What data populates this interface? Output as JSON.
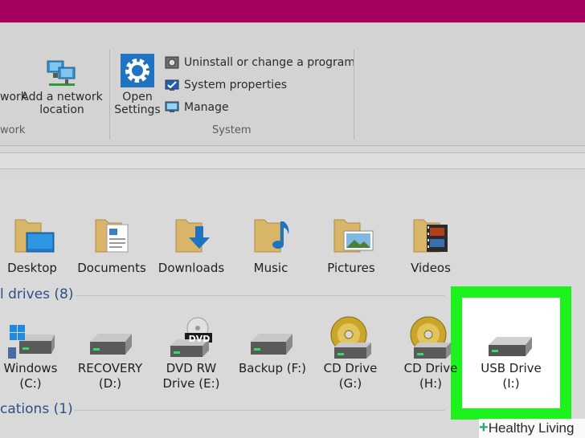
{
  "ribbon": {
    "network_group": {
      "partial_button": "work",
      "add_network_location": [
        "Add a network",
        "location"
      ],
      "group_label": "work"
    },
    "system_group": {
      "open_settings": [
        "Open",
        "Settings"
      ],
      "uninstall": "Uninstall or change a program",
      "system_properties": "System properties",
      "manage": "Manage",
      "group_label": "System"
    }
  },
  "folders": [
    {
      "label": "Desktop"
    },
    {
      "label": "Documents"
    },
    {
      "label": "Downloads"
    },
    {
      "label": "Music"
    },
    {
      "label": "Pictures"
    },
    {
      "label": "Videos"
    }
  ],
  "drives_section": {
    "title": "l drives (8)"
  },
  "drives": [
    {
      "line1": "Windows",
      "line2": "(C:)"
    },
    {
      "line1": "RECOVERY",
      "line2": "(D:)"
    },
    {
      "line1": "DVD RW",
      "line2": "Drive (E:)",
      "badge": "DVD"
    },
    {
      "line1": "Backup (F:)",
      "line2": ""
    },
    {
      "line1": "CD Drive",
      "line2": "(G:)"
    },
    {
      "line1": "CD Drive",
      "line2": "(H:)"
    },
    {
      "line1": "USB Drive",
      "line2": "(I:)"
    }
  ],
  "locations_section": {
    "title": "cations (1)"
  },
  "watermark": {
    "plus": "+",
    "text": "Healthy Living"
  },
  "colors": {
    "titlebar": "#a5005f",
    "highlight": "#1cf21c",
    "section_head": "#2d4f86"
  }
}
